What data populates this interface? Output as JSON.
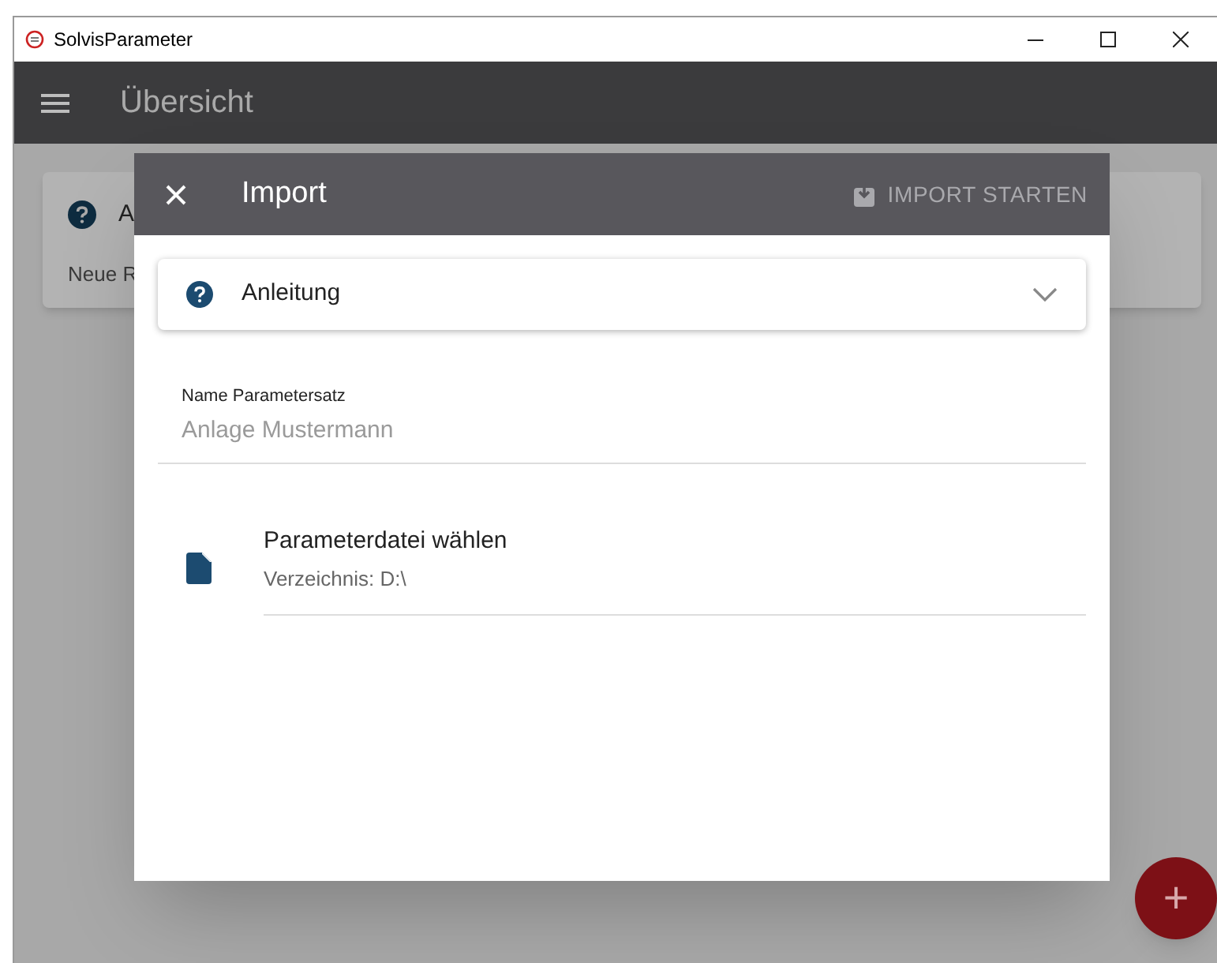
{
  "window": {
    "title": "SolvisParameter"
  },
  "app_bar": {
    "title": "Übersicht"
  },
  "background_card": {
    "title": "A",
    "text": "Neue R"
  },
  "dialog": {
    "title": "Import",
    "action": "IMPORT STARTEN",
    "disabled": true,
    "help": {
      "label": "Anleitung",
      "expanded": false
    },
    "name_field": {
      "label": "Name Parametersatz",
      "placeholder": "Anlage Mustermann"
    },
    "file_item": {
      "title": "Parameterdatei wählen",
      "subtitle": "Verzeichnis: D:\\"
    }
  },
  "fab": {
    "label": "+"
  }
}
